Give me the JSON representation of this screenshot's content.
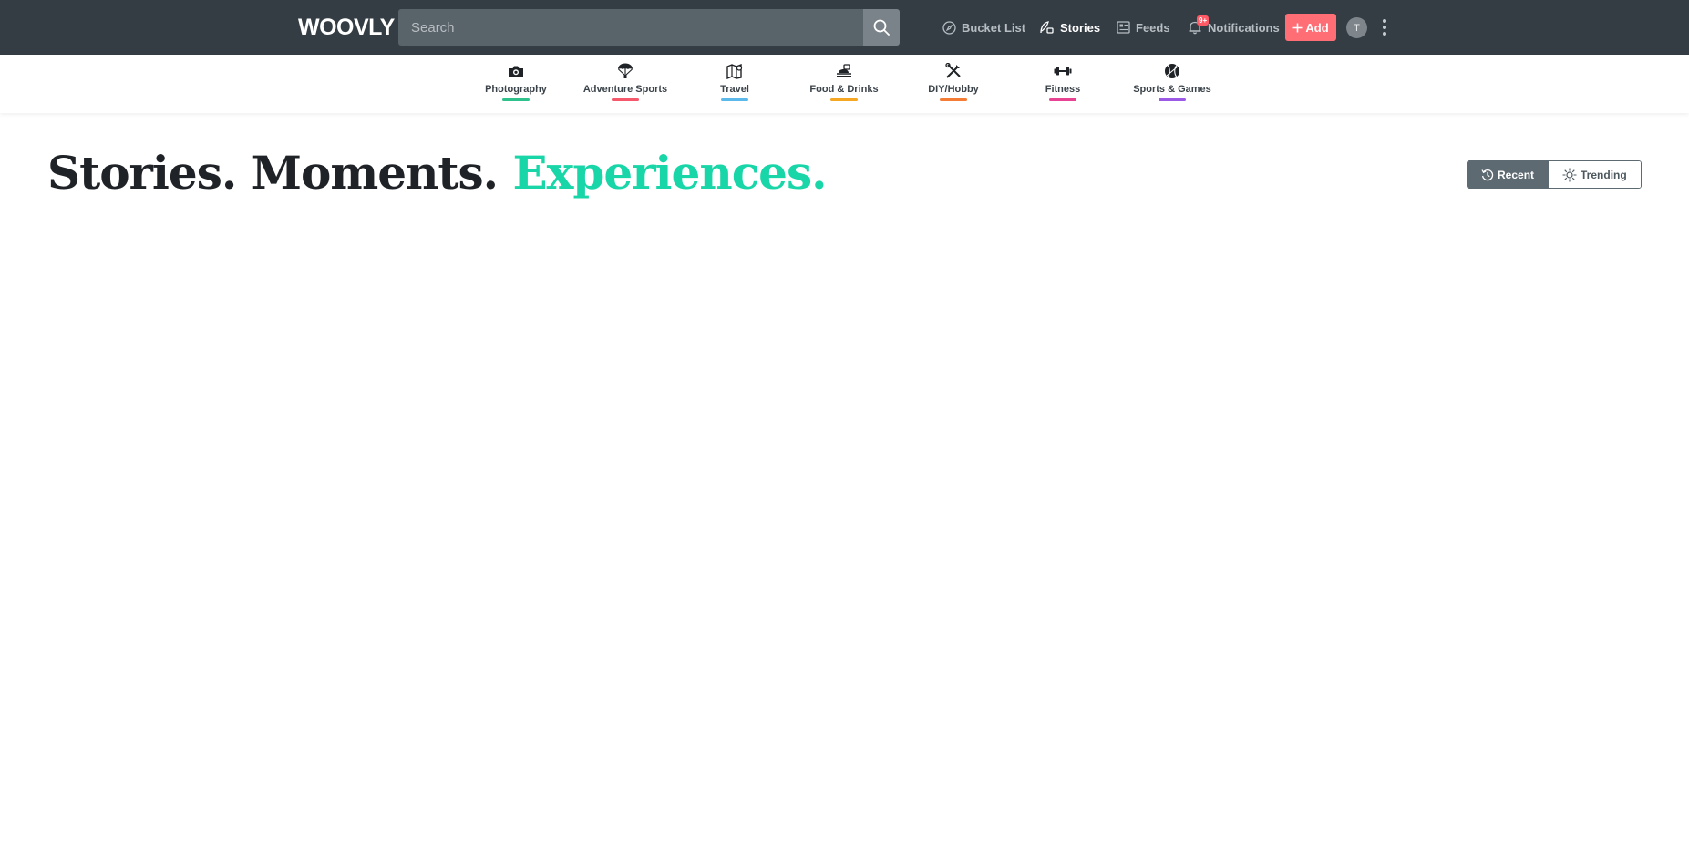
{
  "brand": {
    "logo_text": "WOOVLY"
  },
  "search": {
    "placeholder": "Search"
  },
  "top_nav": {
    "bucket_list": "Bucket List",
    "stories": "Stories",
    "feeds": "Feeds",
    "notifications": "Notifications",
    "notifications_badge": "9+",
    "add_label": "Add",
    "avatar_initial": "T"
  },
  "categories": [
    {
      "label": "Photography",
      "icon": "camera-icon",
      "color": "#2fc18c"
    },
    {
      "label": "Adventure Sports",
      "icon": "parachute-icon",
      "color": "#f5586a"
    },
    {
      "label": "Travel",
      "icon": "map-icon",
      "color": "#5bb8ea"
    },
    {
      "label": "Food & Drinks",
      "icon": "food-icon",
      "color": "#f5a623"
    },
    {
      "label": "DIY/Hobby",
      "icon": "tools-icon",
      "color": "#f57c35"
    },
    {
      "label": "Fitness",
      "icon": "dumbbell-icon",
      "color": "#e84393"
    },
    {
      "label": "Sports & Games",
      "icon": "ball-icon",
      "color": "#9b59e6"
    }
  ],
  "headline": {
    "part1": "Stories. Moments.",
    "part2": "Experiences."
  },
  "sort_toggle": {
    "recent": "Recent",
    "trending": "Trending",
    "selected": "Recent"
  },
  "colors": {
    "topbar": "#343d44",
    "accent": "#19d6a8",
    "add_button": "#ff6d75"
  }
}
